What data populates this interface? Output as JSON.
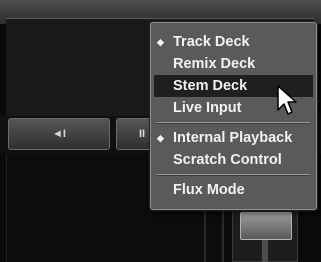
{
  "controls": {
    "button_left_icon": "◄I",
    "button_mid_icon": "II"
  },
  "menu": {
    "items": [
      {
        "label": "Track Deck",
        "checked": true,
        "check_glyph": "◆"
      },
      {
        "label": "Remix Deck",
        "checked": false
      },
      {
        "label": "Stem Deck",
        "checked": false,
        "hovered": true
      },
      {
        "label": "Live Input",
        "checked": false
      },
      {
        "label": "Internal Playback",
        "checked": true,
        "check_glyph": "◆"
      },
      {
        "label": "Scratch Control",
        "checked": false
      },
      {
        "label": "Flux Mode",
        "checked": false
      }
    ]
  },
  "cursor_icon": "arrow-pointer-icon",
  "colors": {
    "menu_bg": "#5a5a5a",
    "menu_text": "#f2f2f2",
    "hover_bg": "#1f1f1f",
    "app_bg": "#070707"
  }
}
